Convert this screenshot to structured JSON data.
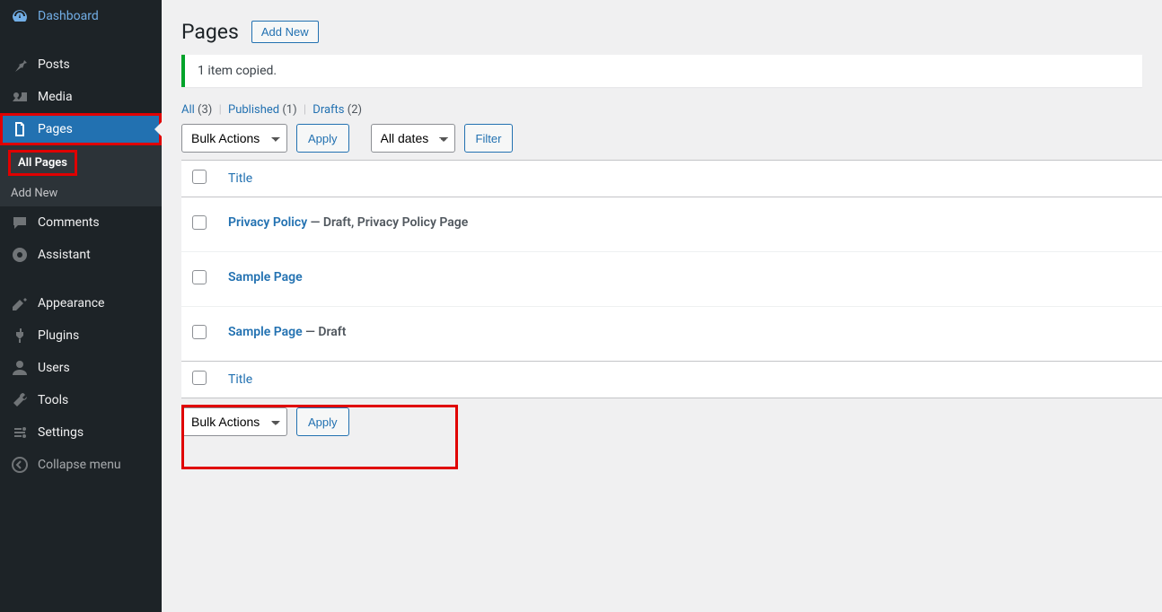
{
  "sidebar": {
    "dashboard": "Dashboard",
    "posts": "Posts",
    "media": "Media",
    "pages": "Pages",
    "pages_sub": {
      "all": "All Pages",
      "add": "Add New"
    },
    "comments": "Comments",
    "assistant": "Assistant",
    "appearance": "Appearance",
    "plugins": "Plugins",
    "users": "Users",
    "tools": "Tools",
    "settings": "Settings",
    "collapse": "Collapse menu"
  },
  "header": {
    "title": "Pages",
    "add_new": "Add New"
  },
  "notice": "1 item copied.",
  "filters": {
    "all_label": "All",
    "all_count": "(3)",
    "published_label": "Published",
    "published_count": "(1)",
    "drafts_label": "Drafts",
    "drafts_count": "(2)"
  },
  "controls": {
    "bulk": "Bulk Actions",
    "apply": "Apply",
    "dates": "All dates",
    "filter": "Filter"
  },
  "table": {
    "title_col": "Title",
    "rows": [
      {
        "title": "Privacy Policy",
        "state": " — Draft, Privacy Policy Page"
      },
      {
        "title": "Sample Page",
        "state": ""
      },
      {
        "title": "Sample Page",
        "state": " — Draft"
      }
    ]
  }
}
